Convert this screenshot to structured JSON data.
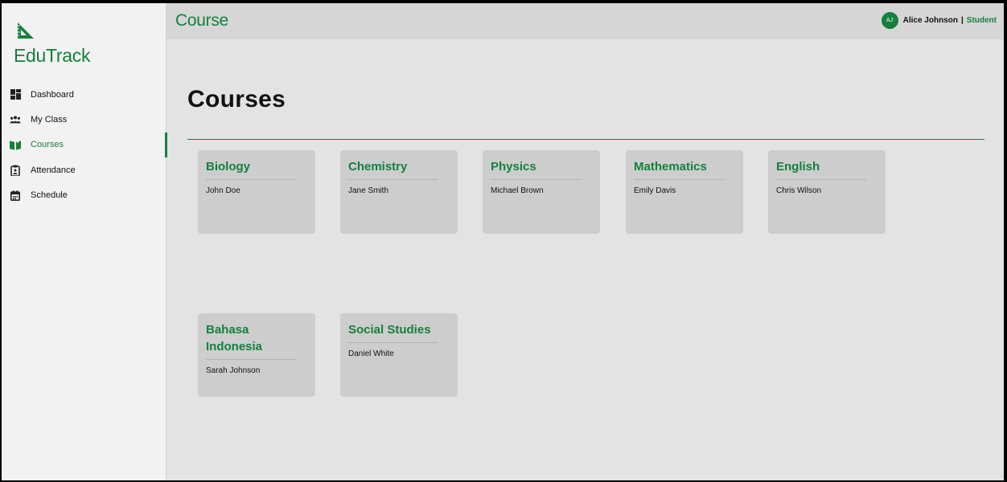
{
  "app": {
    "name": "EduTrack",
    "logo_icon": "set-square-icon",
    "accent_color": "#15803d"
  },
  "sidebar": {
    "items": [
      {
        "label": "Dashboard",
        "icon": "dashboard-icon",
        "active": false
      },
      {
        "label": "My Class",
        "icon": "users-icon",
        "active": false
      },
      {
        "label": "Courses",
        "icon": "book-icon",
        "active": true
      },
      {
        "label": "Attendance",
        "icon": "clipboard-icon",
        "active": false
      },
      {
        "label": "Schedule",
        "icon": "calendar-icon",
        "active": false
      }
    ]
  },
  "header": {
    "title": "Course",
    "user": {
      "initials": "AJ",
      "name": "Alice Johnson",
      "separator": "|",
      "role": "Student"
    }
  },
  "main": {
    "title": "Courses",
    "courses": [
      {
        "name": "Biology",
        "teacher": "John Doe"
      },
      {
        "name": "Chemistry",
        "teacher": "Jane Smith"
      },
      {
        "name": "Physics",
        "teacher": "Michael Brown"
      },
      {
        "name": "Mathematics",
        "teacher": "Emily Davis"
      },
      {
        "name": "English",
        "teacher": "Chris Wilson"
      },
      {
        "name": "Bahasa Indonesia",
        "teacher": "Sarah Johnson"
      },
      {
        "name": "Social Studies",
        "teacher": "Daniel White"
      }
    ]
  }
}
